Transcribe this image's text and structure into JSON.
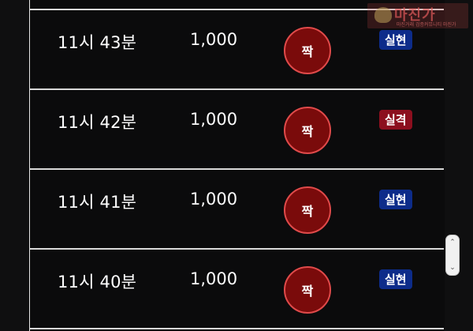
{
  "rows": [
    {
      "time": "11시 43분",
      "amount": "1,000",
      "pick": "짝",
      "result": "실현",
      "result_color": "#0d2c8a"
    },
    {
      "time": "11시 42분",
      "amount": "1,000",
      "pick": "짝",
      "result": "실격",
      "result_color": "#8c0f1e"
    },
    {
      "time": "11시 41분",
      "amount": "1,000",
      "pick": "짝",
      "result": "실현",
      "result_color": "#0d2c8a"
    },
    {
      "time": "11시 40분",
      "amount": "1,000",
      "pick": "짝",
      "result": "실현",
      "result_color": "#0d2c8a"
    }
  ],
  "watermark": {
    "title": "마진가",
    "subtitle": "마진거래 검증커뮤니티 마진가"
  },
  "scroll": {
    "up_icon": "chevron-up-icon",
    "down_icon": "chevron-down-icon"
  }
}
